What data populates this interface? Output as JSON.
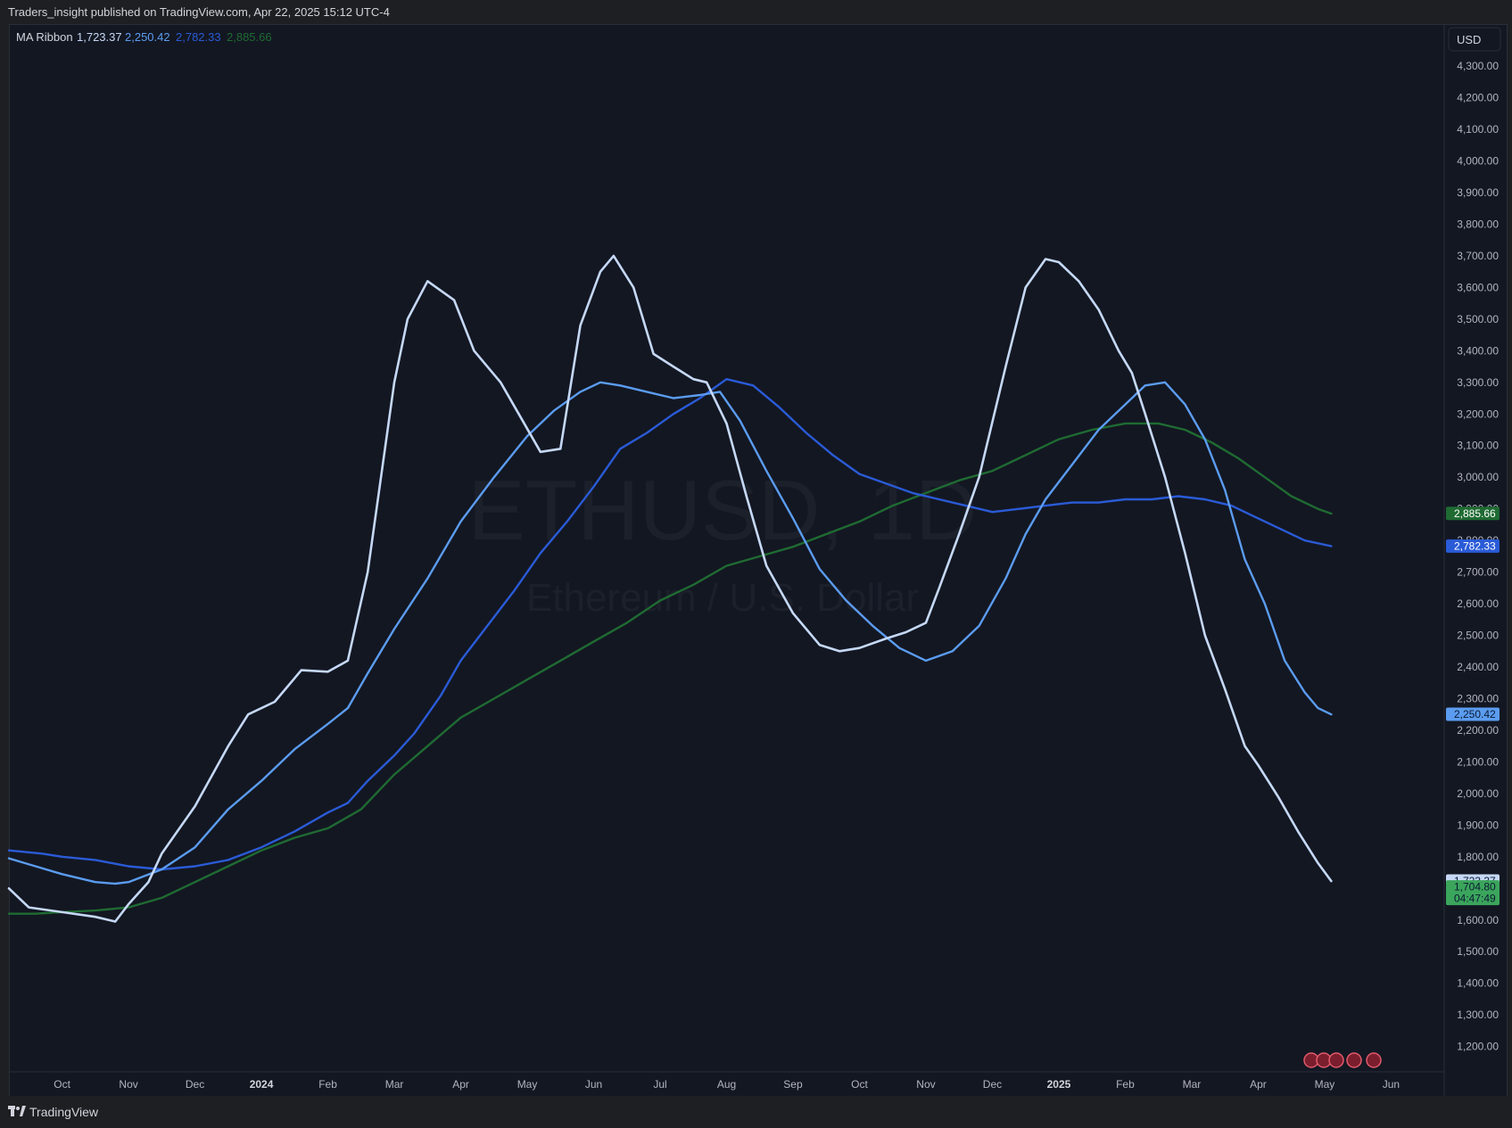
{
  "header": {
    "publisher_text": "Traders_insight published on TradingView.com, Apr 22, 2025 15:12 UTC-4"
  },
  "footer": {
    "brand": "TradingView"
  },
  "watermark": {
    "symbol": "ETHUSD, 1D",
    "name": "Ethereum / U.S. Dollar"
  },
  "currency_button": "USD",
  "legend": {
    "indicator": "MA Ribbon",
    "values": [
      "1,723.37",
      "2,250.42",
      "2,782.33",
      "2,885.66"
    ],
    "colors": [
      "#c5d8f5",
      "#5b9cf0",
      "#2a5bd7",
      "#1f6b32"
    ]
  },
  "price_badges": [
    {
      "text": "2,885.66",
      "value": 2885.66,
      "bg": "#1f6b32",
      "fg": "#ffffff"
    },
    {
      "text": "2,782.33",
      "value": 2782.33,
      "bg": "#2a5bd7",
      "fg": "#ffffff"
    },
    {
      "text": "2,250.42",
      "value": 2250.42,
      "bg": "#5b9cf0",
      "fg": "#0b1a33"
    },
    {
      "text": "1,723.37",
      "value": 1723.37,
      "bg": "#c5d8f5",
      "fg": "#0b1a33"
    },
    {
      "text": "1,704.80",
      "value": 1704.8,
      "bg": "#3ba55c",
      "fg": "#0b1a33"
    },
    {
      "text": "04:47:49",
      "value": 1668,
      "bg": "#3ba55c",
      "fg": "#0b1a33"
    }
  ],
  "chart_data": {
    "type": "line",
    "y_ticks": [
      "4,300.00",
      "4,200.00",
      "4,100.00",
      "4,000.00",
      "3,900.00",
      "3,800.00",
      "3,700.00",
      "3,600.00",
      "3,500.00",
      "3,400.00",
      "3,300.00",
      "3,200.00",
      "3,100.00",
      "3,000.00",
      "2,900.00",
      "2,800.00",
      "2,700.00",
      "2,600.00",
      "2,500.00",
      "2,400.00",
      "2,300.00",
      "2,200.00",
      "2,100.00",
      "2,000.00",
      "1,900.00",
      "1,800.00",
      "1,700.00",
      "1,600.00",
      "1,500.00",
      "1,400.00",
      "1,300.00",
      "1,200.00"
    ],
    "y_tick_values": [
      4300,
      4200,
      4100,
      4000,
      3900,
      3800,
      3700,
      3600,
      3500,
      3400,
      3300,
      3200,
      3100,
      3000,
      2900,
      2800,
      2700,
      2600,
      2500,
      2400,
      2300,
      2200,
      2100,
      2000,
      1900,
      1800,
      1700,
      1600,
      1500,
      1400,
      1300,
      1200
    ],
    "ylim": [
      1120,
      4430
    ],
    "x_labels": [
      "Oct",
      "Nov",
      "Dec",
      "2024",
      "Feb",
      "Mar",
      "Apr",
      "May",
      "Jun",
      "Jul",
      "Aug",
      "Sep",
      "Oct",
      "Nov",
      "Dec",
      "2025",
      "Feb",
      "Mar",
      "Apr",
      "May",
      "Jun"
    ],
    "x_label_index": [
      0,
      1,
      2,
      3,
      4,
      5,
      6,
      7,
      8,
      9,
      10,
      11,
      12,
      13,
      14,
      15,
      16,
      17,
      18,
      19,
      20
    ],
    "x_bold": [
      "2024",
      "2025"
    ],
    "x_domain": [
      -0.8,
      20.8
    ],
    "series": [
      {
        "name": "MA Ribbon",
        "color": "#c5d8f5",
        "points": [
          [
            -0.8,
            1700
          ],
          [
            -0.5,
            1640
          ],
          [
            0,
            1625
          ],
          [
            0.5,
            1610
          ],
          [
            0.8,
            1595
          ],
          [
            1.0,
            1650
          ],
          [
            1.3,
            1720
          ],
          [
            1.5,
            1810
          ],
          [
            2.0,
            1960
          ],
          [
            2.5,
            2150
          ],
          [
            2.8,
            2250
          ],
          [
            3.2,
            2290
          ],
          [
            3.6,
            2390
          ],
          [
            4.0,
            2385
          ],
          [
            4.3,
            2420
          ],
          [
            4.6,
            2700
          ],
          [
            5.0,
            3300
          ],
          [
            5.2,
            3500
          ],
          [
            5.5,
            3620
          ],
          [
            5.9,
            3560
          ],
          [
            6.2,
            3400
          ],
          [
            6.6,
            3300
          ],
          [
            6.9,
            3190
          ],
          [
            7.2,
            3080
          ],
          [
            7.5,
            3090
          ],
          [
            7.8,
            3480
          ],
          [
            8.1,
            3650
          ],
          [
            8.3,
            3700
          ],
          [
            8.6,
            3600
          ],
          [
            8.9,
            3390
          ],
          [
            9.2,
            3350
          ],
          [
            9.5,
            3310
          ],
          [
            9.7,
            3300
          ],
          [
            10.0,
            3170
          ],
          [
            10.3,
            2940
          ],
          [
            10.6,
            2720
          ],
          [
            11.0,
            2570
          ],
          [
            11.4,
            2470
          ],
          [
            11.7,
            2450
          ],
          [
            12.0,
            2460
          ],
          [
            12.4,
            2490
          ],
          [
            12.7,
            2510
          ],
          [
            13.0,
            2540
          ],
          [
            13.2,
            2650
          ],
          [
            13.5,
            2820
          ],
          [
            13.8,
            3000
          ],
          [
            14.2,
            3350
          ],
          [
            14.5,
            3600
          ],
          [
            14.8,
            3690
          ],
          [
            15.0,
            3680
          ],
          [
            15.3,
            3620
          ],
          [
            15.6,
            3530
          ],
          [
            15.9,
            3400
          ],
          [
            16.1,
            3330
          ],
          [
            16.3,
            3200
          ],
          [
            16.6,
            3000
          ],
          [
            16.9,
            2760
          ],
          [
            17.2,
            2500
          ],
          [
            17.5,
            2330
          ],
          [
            17.8,
            2150
          ],
          [
            18.0,
            2090
          ],
          [
            18.3,
            1990
          ],
          [
            18.6,
            1880
          ],
          [
            18.9,
            1780
          ],
          [
            19.1,
            1723
          ]
        ]
      },
      {
        "name": "MA Ribbon",
        "color": "#5b9cf0",
        "points": [
          [
            -0.8,
            1795
          ],
          [
            -0.4,
            1770
          ],
          [
            0,
            1745
          ],
          [
            0.5,
            1720
          ],
          [
            0.8,
            1715
          ],
          [
            1.0,
            1720
          ],
          [
            1.5,
            1760
          ],
          [
            2.0,
            1830
          ],
          [
            2.5,
            1950
          ],
          [
            3.0,
            2040
          ],
          [
            3.5,
            2140
          ],
          [
            4.0,
            2220
          ],
          [
            4.3,
            2270
          ],
          [
            4.6,
            2380
          ],
          [
            5.0,
            2520
          ],
          [
            5.5,
            2680
          ],
          [
            6.0,
            2860
          ],
          [
            6.5,
            3000
          ],
          [
            7.0,
            3130
          ],
          [
            7.4,
            3210
          ],
          [
            7.8,
            3270
          ],
          [
            8.1,
            3300
          ],
          [
            8.4,
            3290
          ],
          [
            8.8,
            3270
          ],
          [
            9.2,
            3250
          ],
          [
            9.6,
            3260
          ],
          [
            9.9,
            3270
          ],
          [
            10.2,
            3180
          ],
          [
            10.6,
            3020
          ],
          [
            11.0,
            2870
          ],
          [
            11.4,
            2710
          ],
          [
            11.8,
            2610
          ],
          [
            12.2,
            2530
          ],
          [
            12.6,
            2460
          ],
          [
            13.0,
            2420
          ],
          [
            13.4,
            2450
          ],
          [
            13.8,
            2530
          ],
          [
            14.2,
            2680
          ],
          [
            14.5,
            2820
          ],
          [
            14.8,
            2930
          ],
          [
            15.2,
            3040
          ],
          [
            15.6,
            3150
          ],
          [
            16.0,
            3230
          ],
          [
            16.3,
            3290
          ],
          [
            16.6,
            3300
          ],
          [
            16.9,
            3230
          ],
          [
            17.2,
            3120
          ],
          [
            17.5,
            2960
          ],
          [
            17.8,
            2740
          ],
          [
            18.1,
            2600
          ],
          [
            18.4,
            2420
          ],
          [
            18.7,
            2320
          ],
          [
            18.9,
            2270
          ],
          [
            19.1,
            2250
          ]
        ]
      },
      {
        "name": "MA Ribbon",
        "color": "#2a5bd7",
        "points": [
          [
            -0.8,
            1820
          ],
          [
            -0.3,
            1810
          ],
          [
            0,
            1800
          ],
          [
            0.5,
            1790
          ],
          [
            1.0,
            1770
          ],
          [
            1.5,
            1760
          ],
          [
            2.0,
            1770
          ],
          [
            2.5,
            1790
          ],
          [
            3.0,
            1830
          ],
          [
            3.5,
            1880
          ],
          [
            4.0,
            1940
          ],
          [
            4.3,
            1970
          ],
          [
            4.6,
            2040
          ],
          [
            5.0,
            2120
          ],
          [
            5.3,
            2190
          ],
          [
            5.7,
            2310
          ],
          [
            6.0,
            2420
          ],
          [
            6.4,
            2530
          ],
          [
            6.8,
            2640
          ],
          [
            7.2,
            2760
          ],
          [
            7.6,
            2860
          ],
          [
            8.0,
            2970
          ],
          [
            8.4,
            3090
          ],
          [
            8.8,
            3140
          ],
          [
            9.2,
            3200
          ],
          [
            9.6,
            3250
          ],
          [
            10.0,
            3310
          ],
          [
            10.4,
            3290
          ],
          [
            10.8,
            3220
          ],
          [
            11.2,
            3140
          ],
          [
            11.6,
            3070
          ],
          [
            12.0,
            3010
          ],
          [
            12.4,
            2980
          ],
          [
            12.8,
            2950
          ],
          [
            13.2,
            2930
          ],
          [
            13.6,
            2910
          ],
          [
            14.0,
            2890
          ],
          [
            14.4,
            2900
          ],
          [
            14.8,
            2910
          ],
          [
            15.2,
            2920
          ],
          [
            15.6,
            2920
          ],
          [
            16.0,
            2930
          ],
          [
            16.4,
            2930
          ],
          [
            16.8,
            2940
          ],
          [
            17.2,
            2930
          ],
          [
            17.6,
            2910
          ],
          [
            17.9,
            2880
          ],
          [
            18.3,
            2840
          ],
          [
            18.7,
            2800
          ],
          [
            19.1,
            2782
          ]
        ]
      },
      {
        "name": "MA Ribbon",
        "color": "#1f6b32",
        "points": [
          [
            -0.8,
            1620
          ],
          [
            -0.4,
            1620
          ],
          [
            0,
            1625
          ],
          [
            0.5,
            1630
          ],
          [
            1.0,
            1640
          ],
          [
            1.5,
            1670
          ],
          [
            2.0,
            1720
          ],
          [
            2.5,
            1770
          ],
          [
            3.0,
            1820
          ],
          [
            3.5,
            1860
          ],
          [
            4.0,
            1890
          ],
          [
            4.5,
            1950
          ],
          [
            5.0,
            2060
          ],
          [
            5.5,
            2150
          ],
          [
            6.0,
            2240
          ],
          [
            6.5,
            2300
          ],
          [
            7.0,
            2360
          ],
          [
            7.5,
            2420
          ],
          [
            8.0,
            2480
          ],
          [
            8.5,
            2540
          ],
          [
            9.0,
            2610
          ],
          [
            9.5,
            2660
          ],
          [
            10.0,
            2720
          ],
          [
            10.5,
            2750
          ],
          [
            11.0,
            2780
          ],
          [
            11.5,
            2820
          ],
          [
            12.0,
            2860
          ],
          [
            12.5,
            2910
          ],
          [
            13.0,
            2950
          ],
          [
            13.5,
            2990
          ],
          [
            14.0,
            3020
          ],
          [
            14.5,
            3070
          ],
          [
            15.0,
            3120
          ],
          [
            15.5,
            3150
          ],
          [
            16.0,
            3170
          ],
          [
            16.5,
            3170
          ],
          [
            16.9,
            3150
          ],
          [
            17.3,
            3110
          ],
          [
            17.7,
            3060
          ],
          [
            18.1,
            3000
          ],
          [
            18.5,
            2940
          ],
          [
            18.9,
            2900
          ],
          [
            19.1,
            2885
          ]
        ]
      }
    ]
  }
}
